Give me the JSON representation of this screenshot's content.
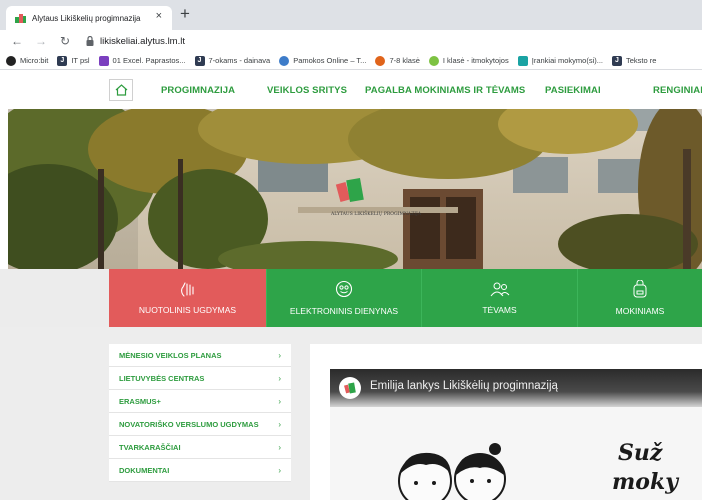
{
  "browser": {
    "tab_title": "Alytaus Likiškelių progimnazija",
    "tab_close": "×",
    "new_tab": "+",
    "url": "likiskeliai.alytus.lm.lt",
    "bookmarks": [
      {
        "label": "Micro:bit",
        "icon": "microbit-icon",
        "color": "#222222"
      },
      {
        "label": "IT psl",
        "icon": "j-icon",
        "color": "#2f3b52"
      },
      {
        "label": "01 Excel. Paprastos...",
        "icon": "excel-icon",
        "color": "#7b3fbf"
      },
      {
        "label": "7-okams - dainava",
        "icon": "j-icon",
        "color": "#2f3b52"
      },
      {
        "label": "Pamokos Online – T...",
        "icon": "pamokos-icon",
        "color": "#3d7cc9"
      },
      {
        "label": "7-8 klasė",
        "icon": "orange-icon",
        "color": "#e0641b"
      },
      {
        "label": "I klasė - itmokytojos",
        "icon": "green-icon",
        "color": "#7dc242"
      },
      {
        "label": "Įrankiai mokymo(si)...",
        "icon": "teal-icon",
        "color": "#1aa3a3"
      },
      {
        "label": "Teksto re",
        "icon": "j-icon",
        "color": "#2f3b52"
      }
    ]
  },
  "site_nav": {
    "items": [
      "PROGIMNAZIJA",
      "VEIKLOS SRITYS",
      "PAGALBA MOKINIAMS IR TĖVAMS",
      "PASIEKIMAI",
      "RENGINIAI"
    ]
  },
  "hero": {
    "sign": "ALYTAUS LIKIŠKELIŲ PROGIMNAZIJA"
  },
  "quick_links": [
    {
      "label": "NUOTOLINIS UGDYMAS",
      "icon": "hand-wave-icon",
      "color": "#e25b5b"
    },
    {
      "label": "ELEKTRONINIS DIENYNAS",
      "icon": "smiley-icon",
      "color": "#2ea449"
    },
    {
      "label": "TĖVAMS",
      "icon": "parents-icon",
      "color": "#2ea449"
    },
    {
      "label": "MOKINIAMS",
      "icon": "backpack-icon",
      "color": "#2ea449"
    }
  ],
  "side_menu": [
    "MĖNESIO VEIKLOS PLANAS",
    "LIETUVYBĖS CENTRAS",
    "ERASMUS+",
    "NOVATORIŠKO VERSLUMO UGDYMAS",
    "TVARKARAŠČIAI",
    "DOKUMENTAI"
  ],
  "video": {
    "title": "Emilija lankys Likiškėlių progimnaziją",
    "line1": "Suž",
    "line2": "moky"
  },
  "colors": {
    "brand_green": "#2ea449",
    "accent_red": "#e25b5b"
  }
}
